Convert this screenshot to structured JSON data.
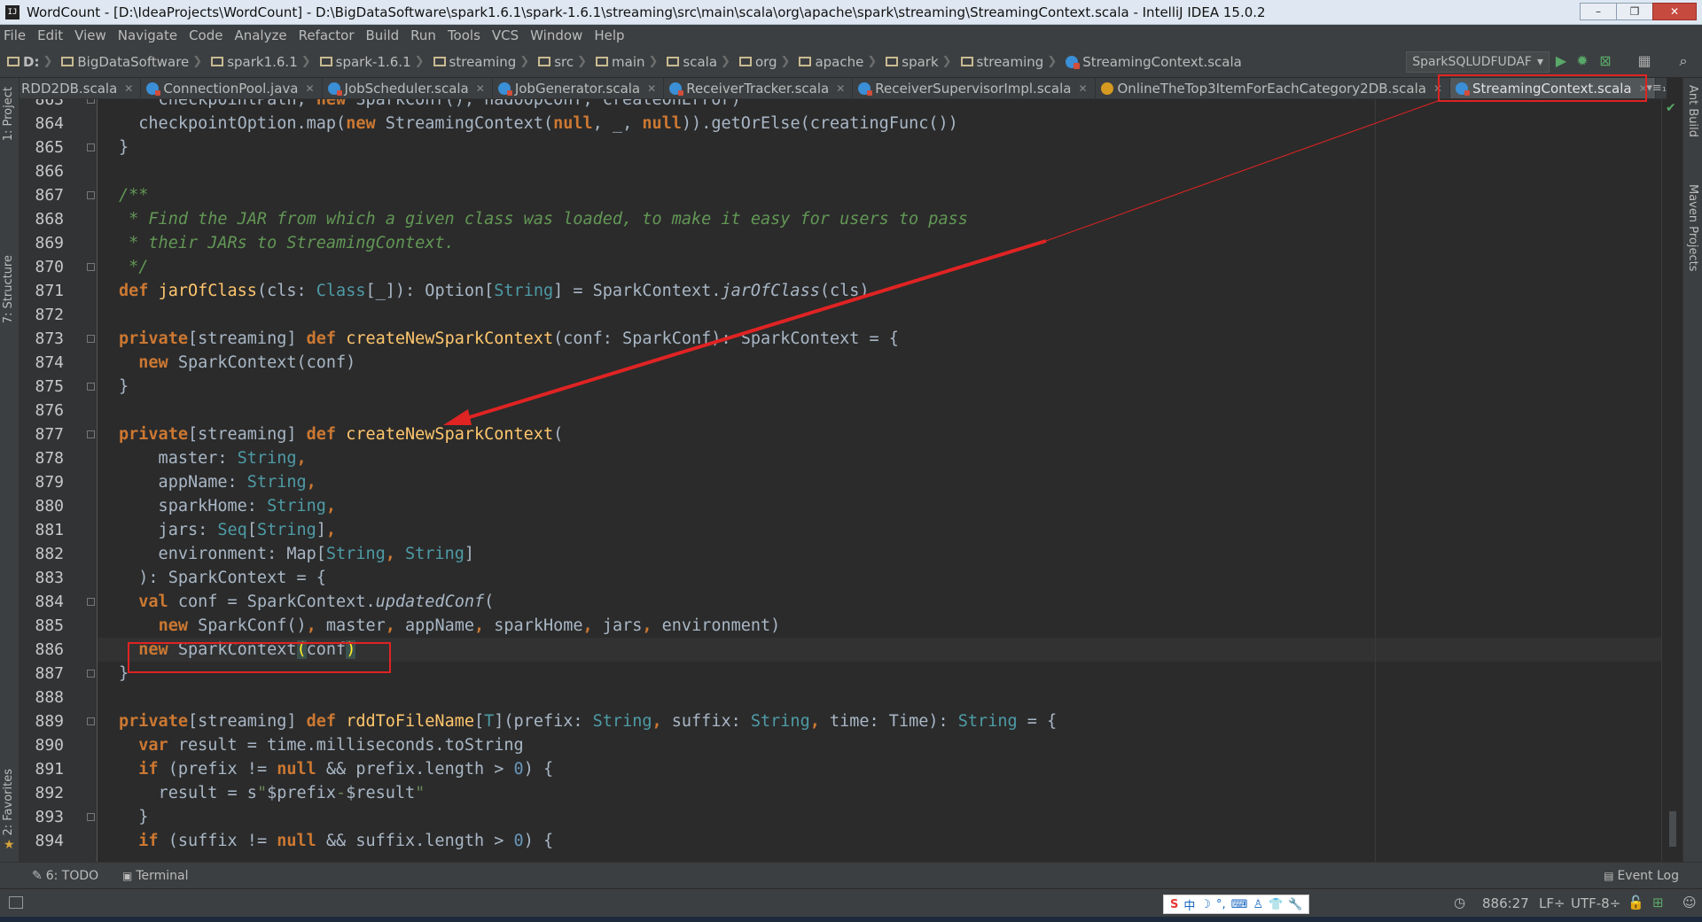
{
  "window": {
    "title": "WordCount - [D:\\IdeaProjects\\WordCount] - D:\\BigDataSoftware\\spark1.6.1\\spark-1.6.1\\streaming\\src\\main\\scala\\org\\apache\\spark\\streaming\\StreamingContext.scala - IntelliJ IDEA 15.0.2",
    "minimize": "–",
    "maximize": "❐",
    "close": "✕"
  },
  "menu": [
    "File",
    "Edit",
    "View",
    "Navigate",
    "Code",
    "Analyze",
    "Refactor",
    "Build",
    "Run",
    "Tools",
    "VCS",
    "Window",
    "Help"
  ],
  "breadcrumbs": [
    "D:",
    "BigDataSoftware",
    "spark1.6.1",
    "spark-1.6.1",
    "streaming",
    "src",
    "main",
    "scala",
    "org",
    "apache",
    "spark",
    "streaming",
    "StreamingContext.scala"
  ],
  "run_config": "SparkSQLUDFUDAF",
  "tabs": [
    {
      "label": "RDD2DB.scala",
      "icon": "scala-class-icon",
      "active": false
    },
    {
      "label": "ConnectionPool.java",
      "icon": "java-class-icon",
      "active": false
    },
    {
      "label": "JobScheduler.scala",
      "icon": "scala-class-icon",
      "active": false
    },
    {
      "label": "JobGenerator.scala",
      "icon": "scala-class-icon",
      "active": false
    },
    {
      "label": "ReceiverTracker.scala",
      "icon": "scala-class-icon",
      "active": false
    },
    {
      "label": "ReceiverSupervisorImpl.scala",
      "icon": "scala-class-icon",
      "active": false
    },
    {
      "label": "OnlineTheTop3ItemForEachCategory2DB.scala",
      "icon": "scala-object-icon",
      "active": false
    },
    {
      "label": "StreamingContext.scala",
      "icon": "scala-class-icon",
      "active": true
    }
  ],
  "tabs_more": "▾≡₁",
  "left_tools": {
    "project": "1: Project",
    "structure": "7: Structure",
    "favorites": "2: Favorites"
  },
  "right_tools": {
    "ant": "Ant Build",
    "maven": "Maven Projects"
  },
  "code": {
    "line_numbers": [
      "863",
      "864",
      "865",
      "866",
      "867",
      "868",
      "869",
      "870",
      "871",
      "872",
      "873",
      "874",
      "875",
      "876",
      "877",
      "878",
      "879",
      "880",
      "881",
      "882",
      "883",
      "884",
      "885",
      "886",
      "887",
      "888",
      "889",
      "890",
      "891",
      "892",
      "893",
      "894"
    ],
    "caret_line_index": 23
  },
  "bottom_tools": {
    "todo": "6: TODO",
    "terminal": "Terminal",
    "event_log": "Event Log"
  },
  "status": {
    "position": "886:27",
    "line_sep": "LF÷",
    "encoding": "UTF-8÷",
    "ime": [
      "中",
      "☽",
      "°,",
      "⌨",
      "♙",
      "👕",
      "🔧"
    ]
  },
  "colors": {
    "annotation_red": "#e02323",
    "keyword": "#cc7832",
    "type": "#4e9ba6",
    "comment": "#629755",
    "function": "#ffc66d"
  }
}
